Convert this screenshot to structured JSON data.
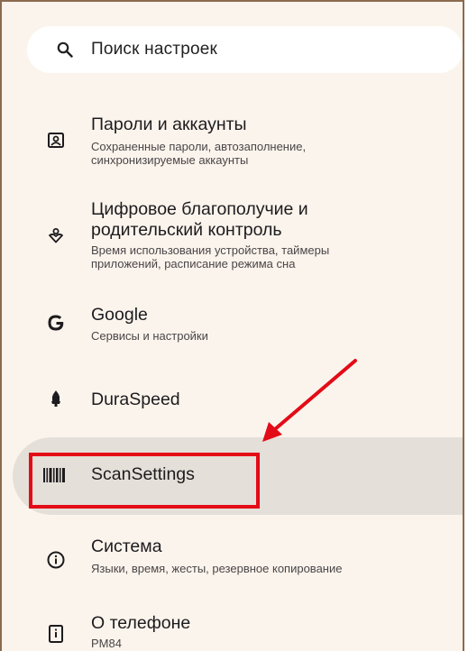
{
  "search": {
    "placeholder": "Поиск настроек",
    "icon": "search-icon"
  },
  "items": [
    {
      "icon": "account-box-icon",
      "title": "Пароли и аккаунты",
      "subtitle": "Сохраненные пароли, автозаполнение,",
      "subtitle2": "синхронизируемые аккаунты"
    },
    {
      "icon": "digital-wellbeing-icon",
      "title": "Цифровое благополучие и",
      "title2": "родительский контроль",
      "subtitle": "Время использования устройства, таймеры",
      "subtitle2": "приложений, расписание режима сна"
    },
    {
      "icon": "google-icon",
      "title": "Google",
      "subtitle": "Сервисы и настройки"
    },
    {
      "icon": "duraspeed-icon",
      "title": "DuraSpeed"
    },
    {
      "icon": "barcode-icon",
      "title": "ScanSettings",
      "highlighted": true
    },
    {
      "icon": "info-icon",
      "title": "Система",
      "subtitle": "Языки, время, жесты, резервное копирование"
    },
    {
      "icon": "phone-info-icon",
      "title": "О телефоне",
      "subtitle": "PM84"
    }
  ],
  "annotation": {
    "color": "#e30b17"
  },
  "colors": {
    "background": "#fbf4ec",
    "highlight": "#e4dfd8",
    "border": "#8b6a4e"
  }
}
